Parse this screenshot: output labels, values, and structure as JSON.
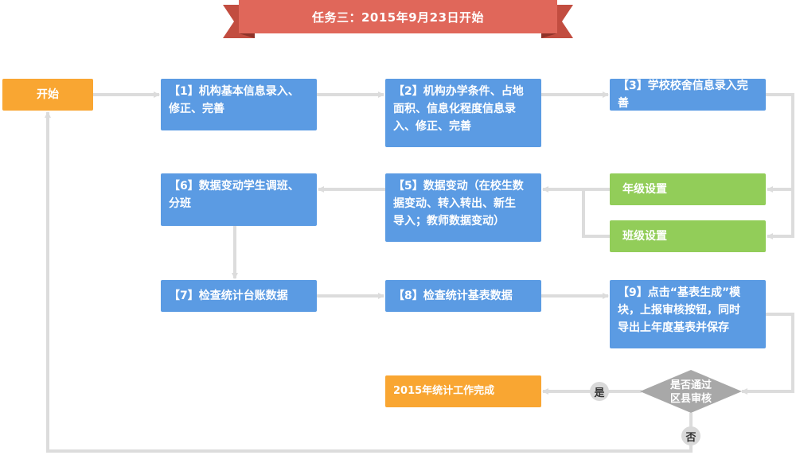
{
  "header": {
    "title": "任务三：2015年9月23日开始"
  },
  "colors": {
    "blue": "#5b9be3",
    "green": "#92cd59",
    "orange": "#f9a632",
    "ribbon": "#e0675a",
    "connector": "#dcdcdc",
    "decision": "#a8a8a8"
  },
  "nodes": {
    "start": "开始",
    "step1": "【1】机构基本信息录入、\n修正、完善",
    "step2": "【2】机构办学条件、占地\n面积、信息化程度信息录\n入、修正、完善",
    "step3": "【3】学校校舍信息录入完善",
    "grade": "年级设置",
    "class": "班级设置",
    "step5": "【5】数据变动（在校生数\n据变动、转入转出、新生\n导入；教师数据变动）",
    "step6": "【6】数据变动学生调班、\n分班",
    "step7": "【7】检查统计台账数据",
    "step8": "【8】检查统计基表数据",
    "step9": "【9】点击“基表生成”模\n块，上报审核按钮，同时\n导出上年度基表并保存",
    "decision": "是否通过\n区县审核",
    "yes": "是",
    "no": "否",
    "finish": "2015年统计工作完成"
  }
}
